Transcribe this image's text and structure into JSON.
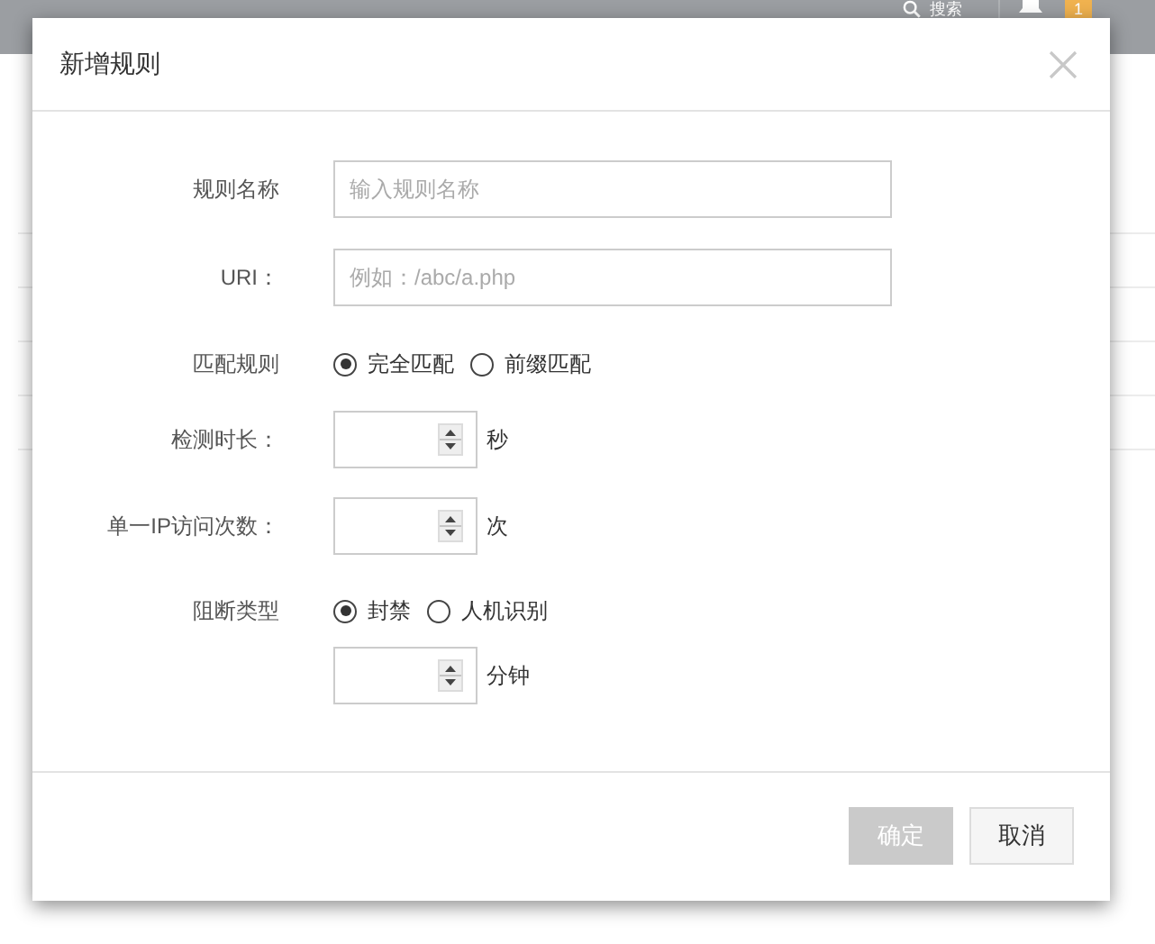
{
  "top_bar": {
    "search_label": "搜索",
    "notification_count": "1"
  },
  "dialog": {
    "title": "新增规则",
    "fields": [
      {
        "kind": "text",
        "label": "规则名称",
        "placeholder": "输入规则名称"
      },
      {
        "kind": "text",
        "label": "URI：",
        "placeholder": "例如：/abc/a.php"
      },
      {
        "kind": "radio",
        "label": "匹配规则",
        "options": [
          {
            "label": "完全匹配",
            "selected": true
          },
          {
            "label": "前缀匹配",
            "selected": false
          }
        ]
      },
      {
        "kind": "number",
        "label": "检测时长：",
        "unit": "秒"
      },
      {
        "kind": "number",
        "label": "单一IP访问次数：",
        "unit": "次"
      },
      {
        "kind": "radio",
        "label": "阻断类型",
        "options": [
          {
            "label": "封禁",
            "selected": true
          },
          {
            "label": "人机识别",
            "selected": false
          }
        ]
      },
      {
        "kind": "number",
        "unit": "分钟"
      }
    ],
    "buttons": [
      {
        "label": "确定",
        "disabled": true
      },
      {
        "label": "取消",
        "disabled": false
      }
    ]
  }
}
